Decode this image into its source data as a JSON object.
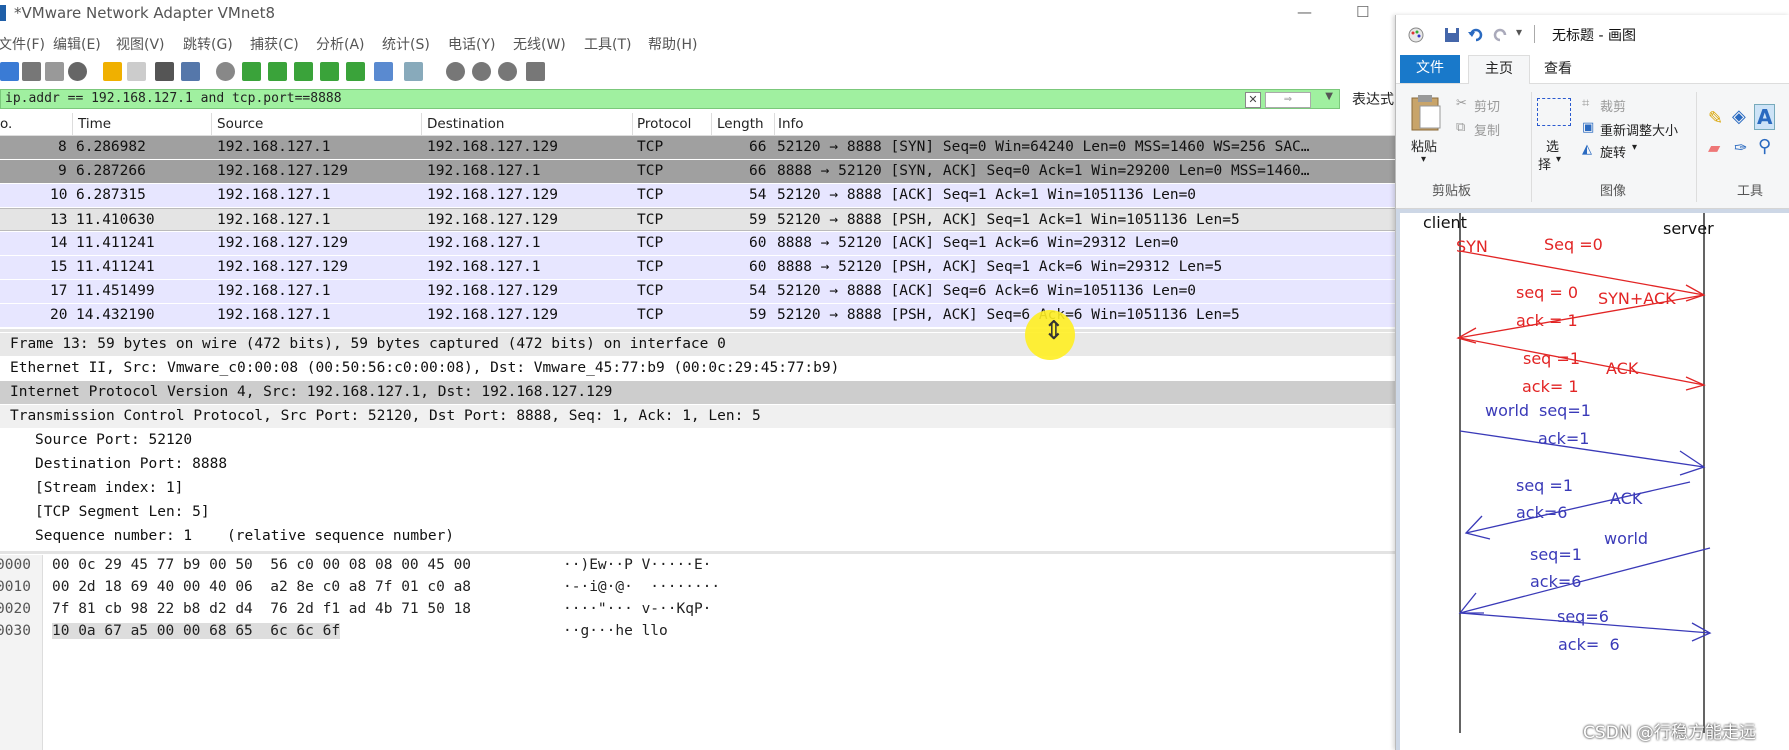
{
  "wireshark": {
    "title": "*VMware Network Adapter VMnet8",
    "menu": [
      "文件(F)",
      "编辑(E)",
      "视图(V)",
      "跳转(G)",
      "捕获(C)",
      "分析(A)",
      "统计(S)",
      "电话(Y)",
      "无线(W)",
      "工具(T)",
      "帮助(H)"
    ],
    "filter": "ip.addr == 192.168.127.1 and tcp.port==8888",
    "expression_label": "表达式",
    "columns": {
      "no": "o.",
      "time": "Time",
      "source": "Source",
      "destination": "Destination",
      "protocol": "Protocol",
      "length": "Length",
      "info": "Info"
    },
    "packets": [
      {
        "no": "8",
        "time": "6.286982",
        "src": "192.168.127.1",
        "dst": "192.168.127.129",
        "proto": "TCP",
        "len": "66",
        "info": "52120 → 8888 [SYN] Seq=0 Win=64240 Len=0 MSS=1460 WS=256 SAC…"
      },
      {
        "no": "9",
        "time": "6.287266",
        "src": "192.168.127.129",
        "dst": "192.168.127.1",
        "proto": "TCP",
        "len": "66",
        "info": "8888 → 52120 [SYN, ACK] Seq=0 Ack=1 Win=29200 Len=0 MSS=1460…"
      },
      {
        "no": "10",
        "time": "6.287315",
        "src": "192.168.127.1",
        "dst": "192.168.127.129",
        "proto": "TCP",
        "len": "54",
        "info": "52120 → 8888 [ACK] Seq=1 Ack=1 Win=1051136 Len=0"
      },
      {
        "no": "13",
        "time": "11.410630",
        "src": "192.168.127.1",
        "dst": "192.168.127.129",
        "proto": "TCP",
        "len": "59",
        "info": "52120 → 8888 [PSH, ACK] Seq=1 Ack=1 Win=1051136 Len=5"
      },
      {
        "no": "14",
        "time": "11.411241",
        "src": "192.168.127.129",
        "dst": "192.168.127.1",
        "proto": "TCP",
        "len": "60",
        "info": "8888 → 52120 [ACK] Seq=1 Ack=6 Win=29312 Len=0"
      },
      {
        "no": "15",
        "time": "11.411241",
        "src": "192.168.127.129",
        "dst": "192.168.127.1",
        "proto": "TCP",
        "len": "60",
        "info": "8888 → 52120 [PSH, ACK] Seq=1 Ack=6 Win=29312 Len=5"
      },
      {
        "no": "17",
        "time": "11.451499",
        "src": "192.168.127.1",
        "dst": "192.168.127.129",
        "proto": "TCP",
        "len": "54",
        "info": "52120 → 8888 [ACK] Seq=6 Ack=6 Win=1051136 Len=0"
      },
      {
        "no": "20",
        "time": "14.432190",
        "src": "192.168.127.1",
        "dst": "192.168.127.129",
        "proto": "TCP",
        "len": "59",
        "info": "52120 → 8888 [PSH, ACK] Seq=6 Ack=6 Win=1051136 Len=5"
      }
    ],
    "details": [
      "Frame 13: 59 bytes on wire (472 bits), 59 bytes captured (472 bits) on interface 0",
      "Ethernet II, Src: Vmware_c0:00:08 (00:50:56:c0:00:08), Dst: Vmware_45:77:b9 (00:0c:29:45:77:b9)",
      "Internet Protocol Version 4, Src: 192.168.127.1, Dst: 192.168.127.129",
      "Transmission Control Protocol, Src Port: 52120, Dst Port: 8888, Seq: 1, Ack: 1, Len: 5",
      "Source Port: 52120",
      "Destination Port: 8888",
      "[Stream index: 1]",
      "[TCP Segment Len: 5]",
      "Sequence number: 1    (relative sequence number)"
    ],
    "hex": [
      {
        "off": "0000",
        "bytes": "00 0c 29 45 77 b9 00 50  56 c0 00 08 08 00 45 00",
        "ascii": "··)Ew··P V·····E·"
      },
      {
        "off": "0010",
        "bytes": "00 2d 18 69 40 00 40 06  a2 8e c0 a8 7f 01 c0 a8",
        "ascii": "·-·i@·@·  ········"
      },
      {
        "off": "0020",
        "bytes": "7f 81 cb 98 22 b8 d2 d4  76 2d f1 ad 4b 71 50 18",
        "ascii": "····\"··· v-··KqP·"
      },
      {
        "off": "0030",
        "bytes": "10 0a 67 a5 00 00 68 65  6c 6c 6f",
        "ascii": "··g···he llo"
      }
    ]
  },
  "paint": {
    "title": "无标题 - 画图",
    "tabs": {
      "file": "文件",
      "home": "主页",
      "view": "查看"
    },
    "clipboard": {
      "paste": "粘贴",
      "cut": "剪切",
      "copy": "复制",
      "group": "剪贴板"
    },
    "image": {
      "select": "选",
      "select2": "择",
      "crop": "裁剪",
      "resize": "重新调整大小",
      "rotate": "旋转",
      "group": "图像"
    },
    "tools": {
      "group": "工具"
    },
    "drawing": {
      "client": "client",
      "server": "server",
      "syn": "SYN",
      "seq0a": "Seq =0",
      "seq0b": "seq = 0",
      "synack": "SYN+ACK",
      "ack1a": "ack = 1",
      "seq1a": "seq =1",
      "ackl": "ACK",
      "ack1b": "ack= 1",
      "world1": "world",
      "seq1b": "seq=1",
      "ack1c": "ack=1",
      "seq1c": "seq =1",
      "ack2": "ACK",
      "ack6a": "ack=6",
      "world2": "world",
      "seq1d": "seq=1",
      "ack6b": "ack=6",
      "seq6": "seq=6",
      "ack6c": "ack=  6"
    }
  },
  "watermark": "CSDN @行稳方能走远",
  "colors": {
    "filter_bg": "#a0f0a0",
    "row_gray": "#a0a0a0",
    "row_lav": "#e7e6ff",
    "row_sel": "#cfcfcf",
    "paint_blue": "#1979ca",
    "pen_red": "#e22525",
    "pen_blue": "#3a3ab8"
  }
}
